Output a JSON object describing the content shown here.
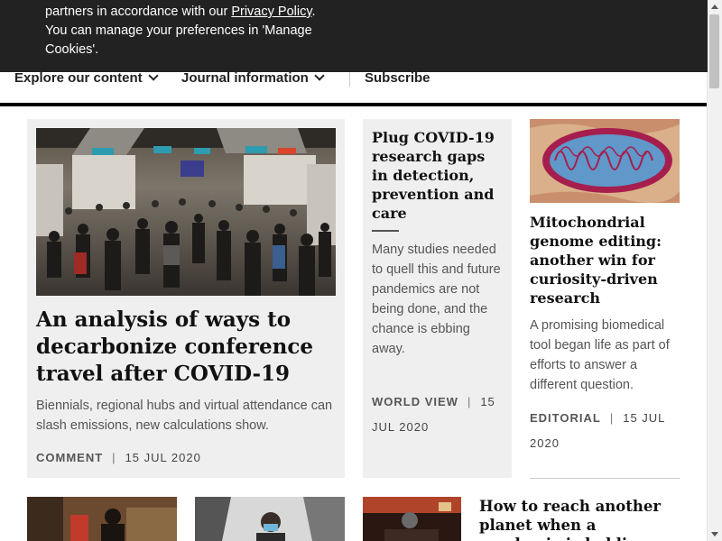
{
  "cookie_banner": {
    "text_start": "partners in accordance with our ",
    "privacy_link": "Privacy Policy",
    "text_end": ". You can manage your preferences in 'Manage Cookies'."
  },
  "nav": {
    "items": [
      {
        "label": "Explore our content"
      },
      {
        "label": "Journal information"
      },
      {
        "label": "Subscribe"
      }
    ]
  },
  "articles": {
    "main": {
      "title": "An analysis of ways to decarbonize conference travel after COVID-19",
      "description": "Biennials, regional hubs and virtual attendance can slash emissions, new calculations show.",
      "type": "COMMENT",
      "date": "15 JUL 2020"
    },
    "middle": {
      "title": "Plug COVID-19 research gaps in detection, prevention and care",
      "description": "Many studies needed to quell this and future pandemics are not being done, and the chance is ebbing away.",
      "type": "WORLD VIEW",
      "date": "15 JUL 2020"
    },
    "right": {
      "title": "Mitochondrial genome editing: another win for curiosity-driven research",
      "description": "A promising biomedical tool began life as part of efforts to answer a different question.",
      "type": "EDITORIAL",
      "date": "15 JUL 2020"
    },
    "bottom_fourth": {
      "title": "How to reach another planet when a pandemic is holding"
    }
  },
  "colors": {
    "banner_bg": "#222222",
    "card_bg": "#efefef",
    "nav_rule": "#000000"
  }
}
